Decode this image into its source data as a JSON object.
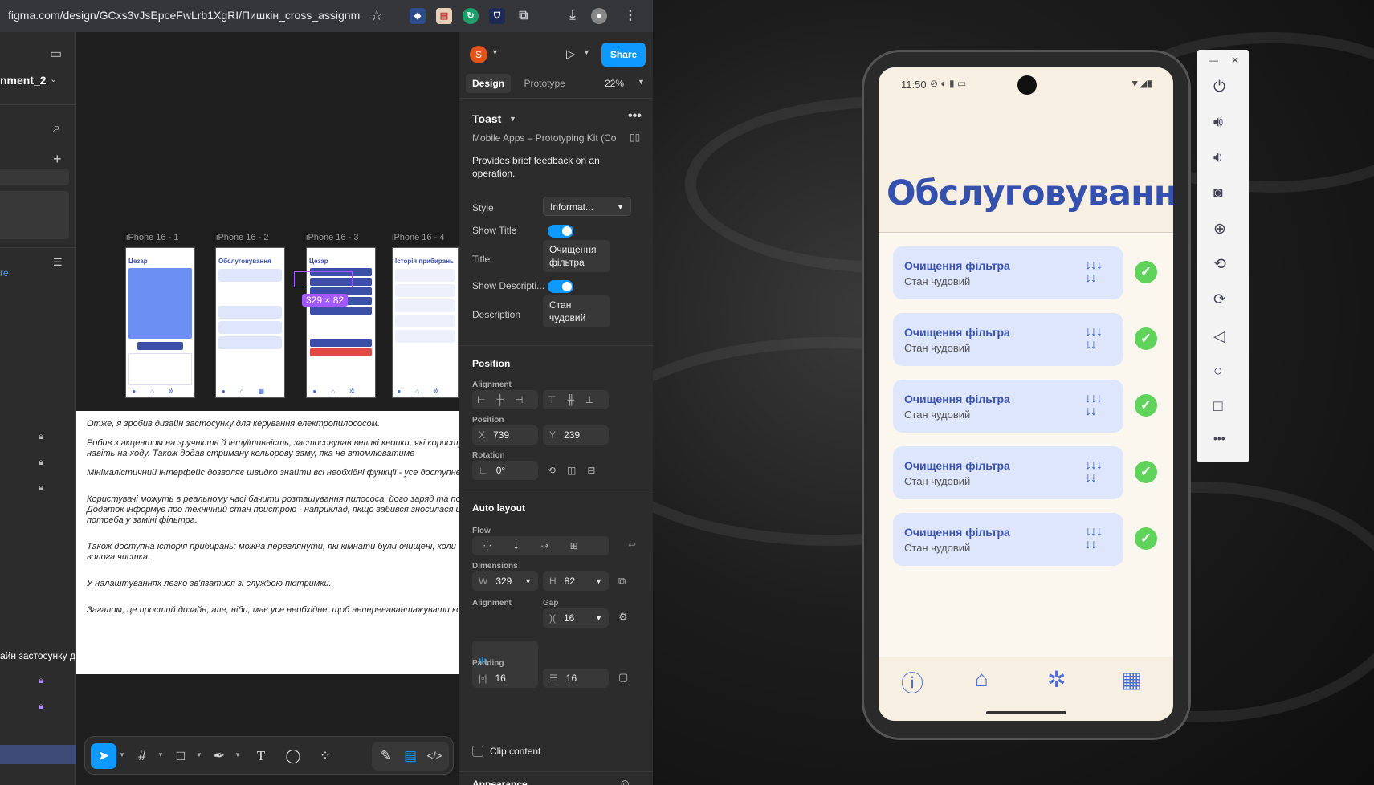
{
  "browser": {
    "url": "figma.com/design/GCxs3vJsEpceFwLrb1XgRI/Пишкін_cross_assignm..."
  },
  "figma_left": {
    "project_name": "nment_2",
    "link_text": "re",
    "layer_text": "айн застосунку д"
  },
  "canvas": {
    "frames": [
      {
        "label": "iPhone 16 - 1",
        "title": "Цезар"
      },
      {
        "label": "iPhone 16 - 2",
        "title": "Обслуговування"
      },
      {
        "label": "iPhone 16 - 3",
        "title": "Цезар"
      },
      {
        "label": "iPhone 16 - 4",
        "title": "Історія прибирань"
      }
    ],
    "dimension_badge": "329 × 82",
    "document_paragraphs": [
      "Отже, я зробив дизайн застосунку для керування електропилососом.",
      "Робив з акцентом на зручність й інтуїтивність, застосовував великі кнопки, які користува натискати навіть на ходу. Також додав стриману кольорову гаму, яка не втомлюватиме",
      "Мінімалістичний інтерфейс дозволяє швидко знайти всі необхідні функції - усе доступне двох кліків.",
      "Користувачі можуть в реальному часі бачити розташування пилососа, його заряд та пот прибирання. Додаток інформує про технічний стан пристрою - наприклад, якщо забився зносилася щітка чи виникла потреба у заміні фільтра.",
      "Також доступна історія прибирань: можна переглянути, які кімнати були очищені, коли с суха чи волога чистка.",
      "У налаштуваннях легко зв'язатися зі службою підтримки.",
      "Загалом, це простий дизайн, але, ніби, має усе необхідне, щоб неперенавантажувати ко"
    ]
  },
  "design_panel": {
    "avatar_letter": "S",
    "share_label": "Share",
    "tabs": [
      "Design",
      "Prototype"
    ],
    "zoom": "22%",
    "component_name": "Toast",
    "library": "Mobile Apps – Prototyping Kit (Co...",
    "description": "Provides brief feedback on an operation.",
    "props": {
      "style_label": "Style",
      "style_value": "Informat...",
      "show_title_label": "Show Title",
      "title_label": "Title",
      "title_value": "Очищення фільтра",
      "show_desc_label": "Show Descripti...",
      "description_label": "Description",
      "description_value": "Стан чудовий"
    },
    "position": {
      "heading": "Position",
      "alignment_label": "Alignment",
      "position_label": "Position",
      "x_key": "X",
      "x": "739",
      "y_key": "Y",
      "y": "239",
      "rotation_label": "Rotation",
      "rotation": "0°"
    },
    "auto_layout": {
      "heading": "Auto layout",
      "flow_label": "Flow",
      "dimensions_label": "Dimensions",
      "w_key": "W",
      "w": "329",
      "h_key": "H",
      "h": "82",
      "alignment_label": "Alignment",
      "gap_label": "Gap",
      "gap": "16",
      "padding_label": "Padding",
      "padding_h": "16",
      "padding_v": "16",
      "clip_label": "Clip content"
    },
    "appearance_heading": "Appearance"
  },
  "phone": {
    "time": "11:50",
    "title": "Обслуговування",
    "items": [
      {
        "title": "Очищення фільтра",
        "status": "Стан чудовий"
      },
      {
        "title": "Очищення фільтра",
        "status": "Стан чудовий"
      },
      {
        "title": "Очищення фільтра",
        "status": "Стан чудовий"
      },
      {
        "title": "Очищення фільтра",
        "status": "Стан чудовий"
      },
      {
        "title": "Очищення фільтра",
        "status": "Стан чудовий"
      }
    ],
    "nav_icons": [
      "info-icon",
      "home-icon",
      "settings-icon",
      "calculator-icon"
    ]
  },
  "colors": {
    "figma_blue": "#0d99ff",
    "figma_purple": "#a259ff",
    "app_primary": "#3650ad",
    "app_card": "#dde6fb",
    "app_ok": "#5fd35a",
    "app_bg": "#fbf6ee"
  },
  "help_label": "?"
}
